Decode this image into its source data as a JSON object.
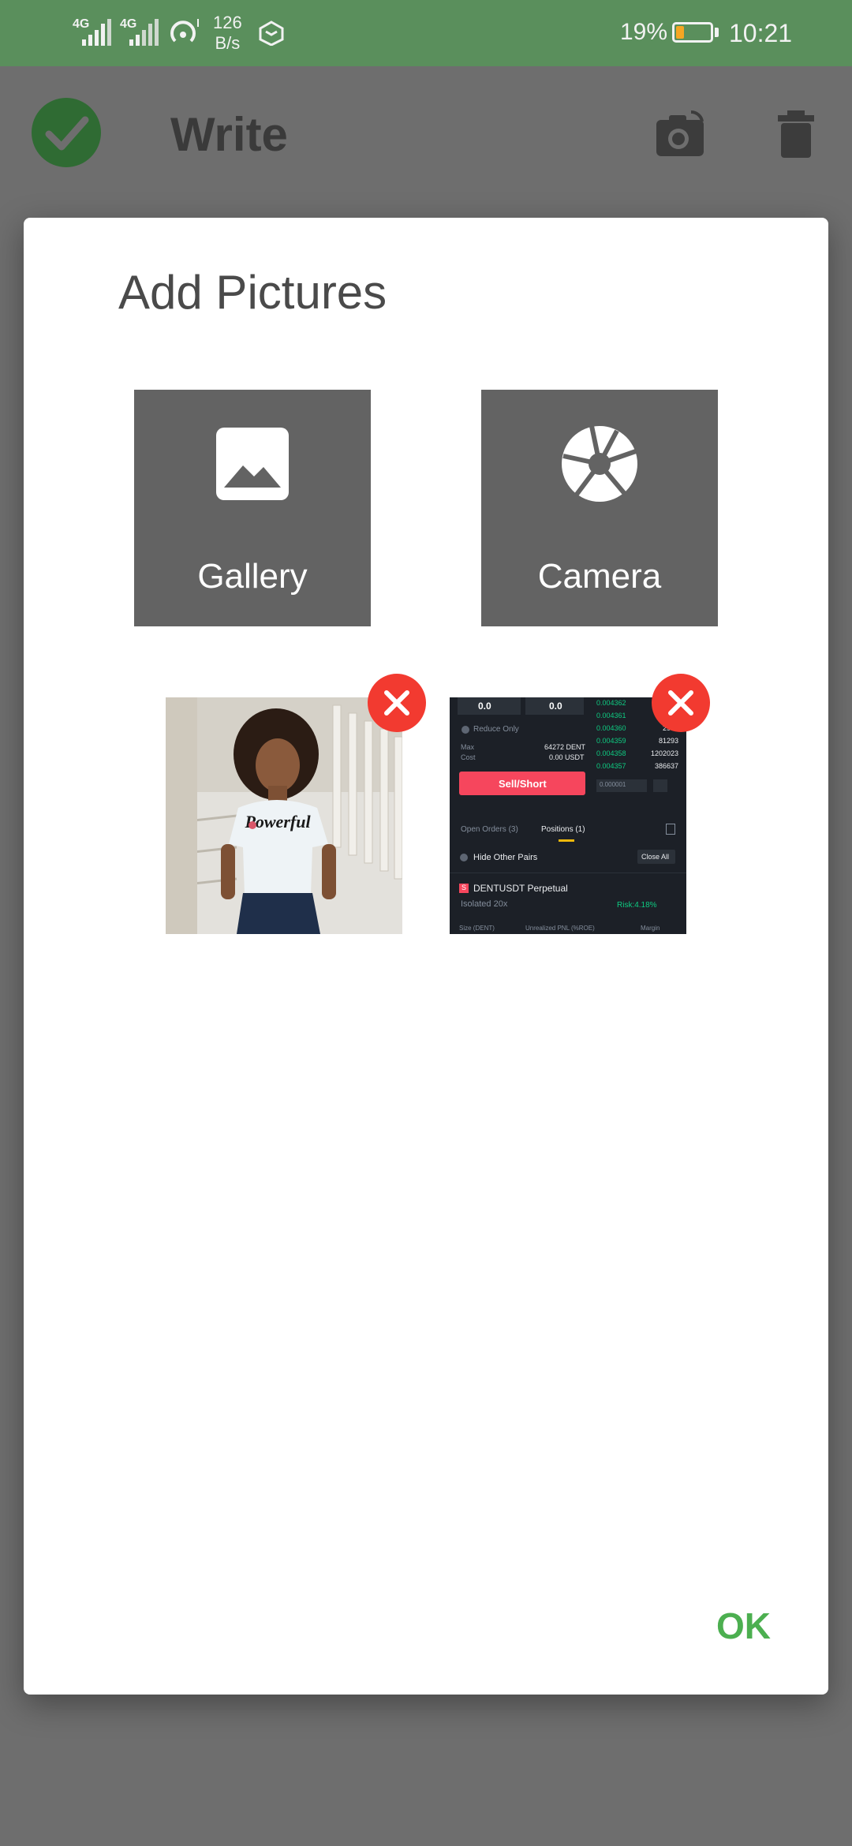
{
  "status_bar": {
    "network_1": "4G",
    "network_2": "4G",
    "speed_value": "126",
    "speed_unit": "B/s",
    "battery": "19%",
    "time": "10:21"
  },
  "app_bar": {
    "title": "Write",
    "icons": [
      "check-icon",
      "camera-icon",
      "trash-icon"
    ]
  },
  "dialog": {
    "title": "Add Pictures",
    "tiles": [
      {
        "label": "Gallery",
        "icon": "image-icon"
      },
      {
        "label": "Camera",
        "icon": "aperture-icon"
      }
    ],
    "ok_label": "OK"
  },
  "thumbnail_1": {
    "shirt_text": "Powerful"
  },
  "thumbnail_2": {
    "input_1": "0.0",
    "input_2": "0.0",
    "reduce_only": "Reduce Only",
    "max_label": "Max",
    "max_value": "64272 DENT",
    "cost_label": "Cost",
    "cost_value": "0.00 USDT",
    "sell_button": "Sell/Short",
    "step_value": "0.000001",
    "order_prices": [
      "0.004362",
      "0.004361",
      "0.004360",
      "0.004359",
      "0.004358",
      "0.004357"
    ],
    "order_sizes": [
      "",
      "",
      "2951",
      "81293",
      "1202023",
      "386637"
    ],
    "tab_open": "Open Orders (3)",
    "tab_positions": "Positions (1)",
    "hide_pairs": "Hide Other Pairs",
    "close_all": "Close All",
    "symbol_badge": "S",
    "symbol": "DENTUSDT Perpetual",
    "isolated": "Isolated 20x",
    "risk": "Risk:4.18%",
    "col_size": "Size (DENT)",
    "col_pnl": "Unrealized PNL (%ROE)",
    "col_margin": "Margin"
  },
  "colors": {
    "status_bar": "#5a8f5c",
    "accent_green": "#4caf50",
    "remove_red": "#f23a30",
    "tile_gray": "#636363"
  }
}
